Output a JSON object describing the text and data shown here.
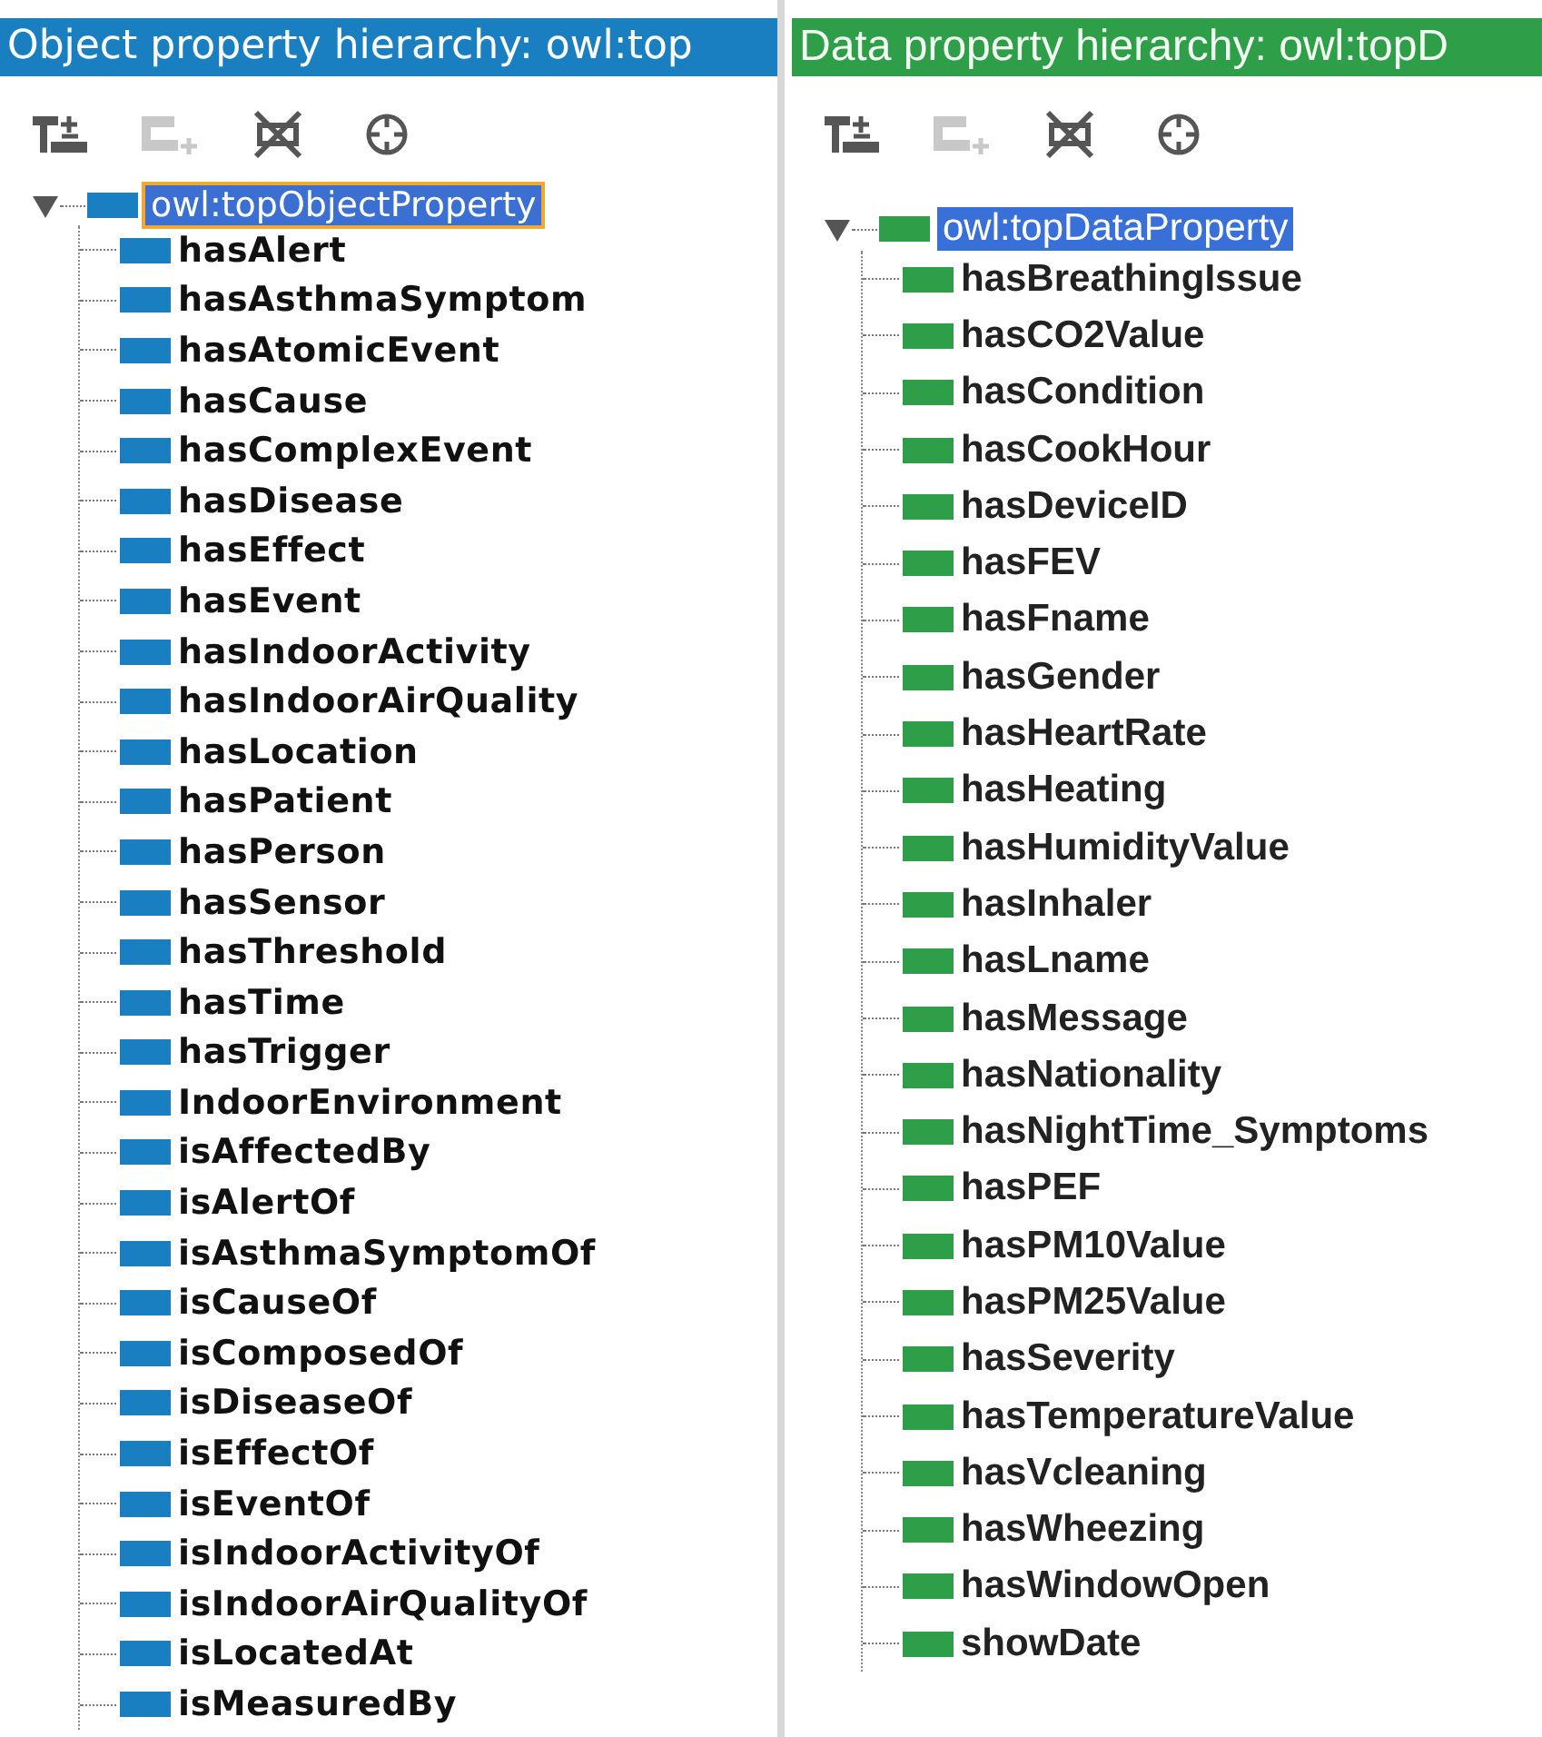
{
  "panels": [
    {
      "kind": "object",
      "title": "Object property hierarchy: owl:top",
      "color": "#1a7fc1",
      "toolbar": [
        {
          "kind": "add-sub",
          "disabled": false
        },
        {
          "kind": "add-sibling",
          "disabled": true
        },
        {
          "kind": "delete",
          "disabled": false
        },
        {
          "kind": "find",
          "disabled": false
        }
      ],
      "tree": {
        "label": "owl:topObjectProperty",
        "selected": true,
        "expanded": true,
        "children": [
          {
            "label": "hasAlert"
          },
          {
            "label": "hasAsthmaSymptom"
          },
          {
            "label": "hasAtomicEvent"
          },
          {
            "label": "hasCause"
          },
          {
            "label": "hasComplexEvent"
          },
          {
            "label": "hasDisease"
          },
          {
            "label": "hasEffect"
          },
          {
            "label": "hasEvent"
          },
          {
            "label": "hasIndoorActivity"
          },
          {
            "label": "hasIndoorAirQuality"
          },
          {
            "label": "hasLocation"
          },
          {
            "label": "hasPatient"
          },
          {
            "label": "hasPerson"
          },
          {
            "label": "hasSensor"
          },
          {
            "label": "hasThreshold"
          },
          {
            "label": "hasTime"
          },
          {
            "label": "hasTrigger"
          },
          {
            "label": "IndoorEnvironment"
          },
          {
            "label": "isAffectedBy"
          },
          {
            "label": "isAlertOf"
          },
          {
            "label": "isAsthmaSymptomOf"
          },
          {
            "label": "isCauseOf"
          },
          {
            "label": "isComposedOf"
          },
          {
            "label": "isDiseaseOf"
          },
          {
            "label": "isEffectOf"
          },
          {
            "label": "isEventOf"
          },
          {
            "label": "isIndoorActivityOf"
          },
          {
            "label": "isIndoorAirQualityOf"
          },
          {
            "label": "isLocatedAt"
          },
          {
            "label": "isMeasuredBy"
          }
        ]
      }
    },
    {
      "kind": "data",
      "title": "Data property hierarchy: owl:topD",
      "color": "#2e9e48",
      "toolbar": [
        {
          "kind": "add-sub",
          "disabled": false
        },
        {
          "kind": "add-sibling",
          "disabled": true
        },
        {
          "kind": "delete",
          "disabled": false
        },
        {
          "kind": "find",
          "disabled": false
        }
      ],
      "tree": {
        "label": "owl:topDataProperty",
        "selected": true,
        "expanded": true,
        "children": [
          {
            "label": "hasBreathingIssue"
          },
          {
            "label": "hasCO2Value"
          },
          {
            "label": "hasCondition"
          },
          {
            "label": "hasCookHour"
          },
          {
            "label": "hasDeviceID"
          },
          {
            "label": "hasFEV"
          },
          {
            "label": "hasFname"
          },
          {
            "label": "hasGender"
          },
          {
            "label": "hasHeartRate"
          },
          {
            "label": "hasHeating"
          },
          {
            "label": "hasHumidityValue"
          },
          {
            "label": "hasInhaler"
          },
          {
            "label": "hasLname"
          },
          {
            "label": "hasMessage"
          },
          {
            "label": "hasNationality"
          },
          {
            "label": "hasNightTime_Symptoms"
          },
          {
            "label": "hasPEF"
          },
          {
            "label": "hasPM10Value"
          },
          {
            "label": "hasPM25Value"
          },
          {
            "label": "hasSeverity"
          },
          {
            "label": "hasTemperatureValue"
          },
          {
            "label": "hasVcleaning"
          },
          {
            "label": "hasWheezing"
          },
          {
            "label": "hasWindowOpen"
          },
          {
            "label": "showDate"
          }
        ]
      }
    }
  ]
}
